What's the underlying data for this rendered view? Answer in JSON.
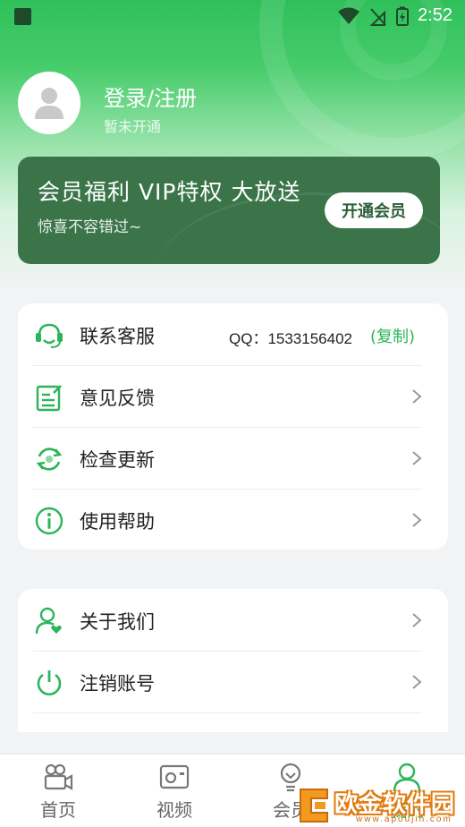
{
  "status_bar": {
    "time": "2:52"
  },
  "profile": {
    "login_text": "登录/注册",
    "status": "暂未开通"
  },
  "vip_banner": {
    "title": "会员福利  VIP特权  大放送",
    "subtitle": "惊喜不容错过~",
    "button_label": "开通会员"
  },
  "menu_group_1": [
    {
      "label": "联系客服",
      "icon": "customer-service-icon",
      "qq_text": "QQ：1533156402",
      "copy_label": "(复制)"
    },
    {
      "label": "意见反馈",
      "icon": "feedback-icon"
    },
    {
      "label": "检查更新",
      "icon": "refresh-icon"
    },
    {
      "label": "使用帮助",
      "icon": "info-icon"
    }
  ],
  "menu_group_2": [
    {
      "label": "关于我们",
      "icon": "user-heart-icon"
    },
    {
      "label": "注销账号",
      "icon": "power-icon"
    }
  ],
  "bottom_nav": [
    {
      "label": "首页",
      "icon": "camera-icon"
    },
    {
      "label": "视频",
      "icon": "video-icon"
    },
    {
      "label": "会员",
      "icon": "bulb-icon"
    },
    {
      "label": "我的",
      "icon": "user-icon",
      "active": true
    }
  ],
  "watermark": {
    "text": "欧金软件园",
    "url": "www.apoujin.com"
  },
  "colors": {
    "accent": "#2bb55a",
    "banner": "#3a7448"
  }
}
